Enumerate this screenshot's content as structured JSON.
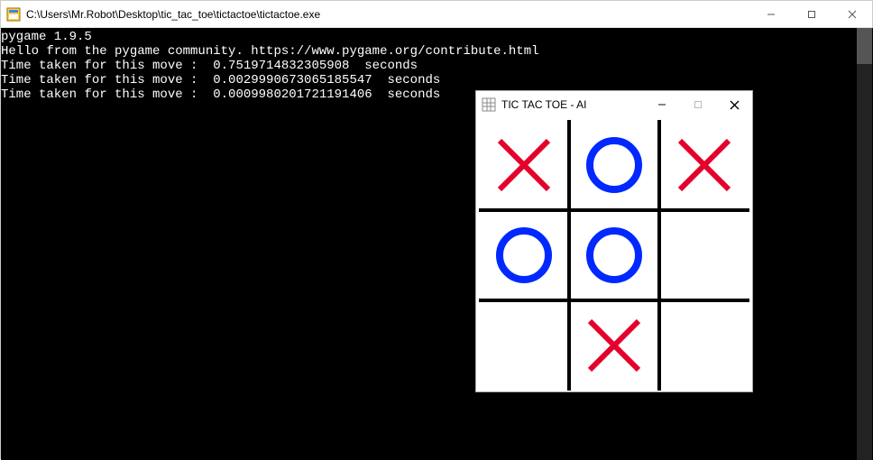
{
  "console": {
    "title": "C:\\Users\\Mr.Robot\\Desktop\\tic_tac_toe\\tictactoe\\tictactoe.exe",
    "lines": [
      "pygame 1.9.5",
      "Hello from the pygame community. https://www.pygame.org/contribute.html",
      "Time taken for this move :  0.7519714832305908  seconds",
      "Time taken for this move :  0.0029990673065185547  seconds",
      "Time taken for this move :  0.0009980201721191406  seconds"
    ]
  },
  "game": {
    "title": "TIC TAC TOE - AI",
    "board": [
      [
        "X",
        "O",
        "X"
      ],
      [
        "O",
        "O",
        ""
      ],
      [
        "",
        "X",
        ""
      ]
    ],
    "colors": {
      "x": "#e4002b",
      "o": "#0028ff",
      "grid": "#000000"
    }
  }
}
